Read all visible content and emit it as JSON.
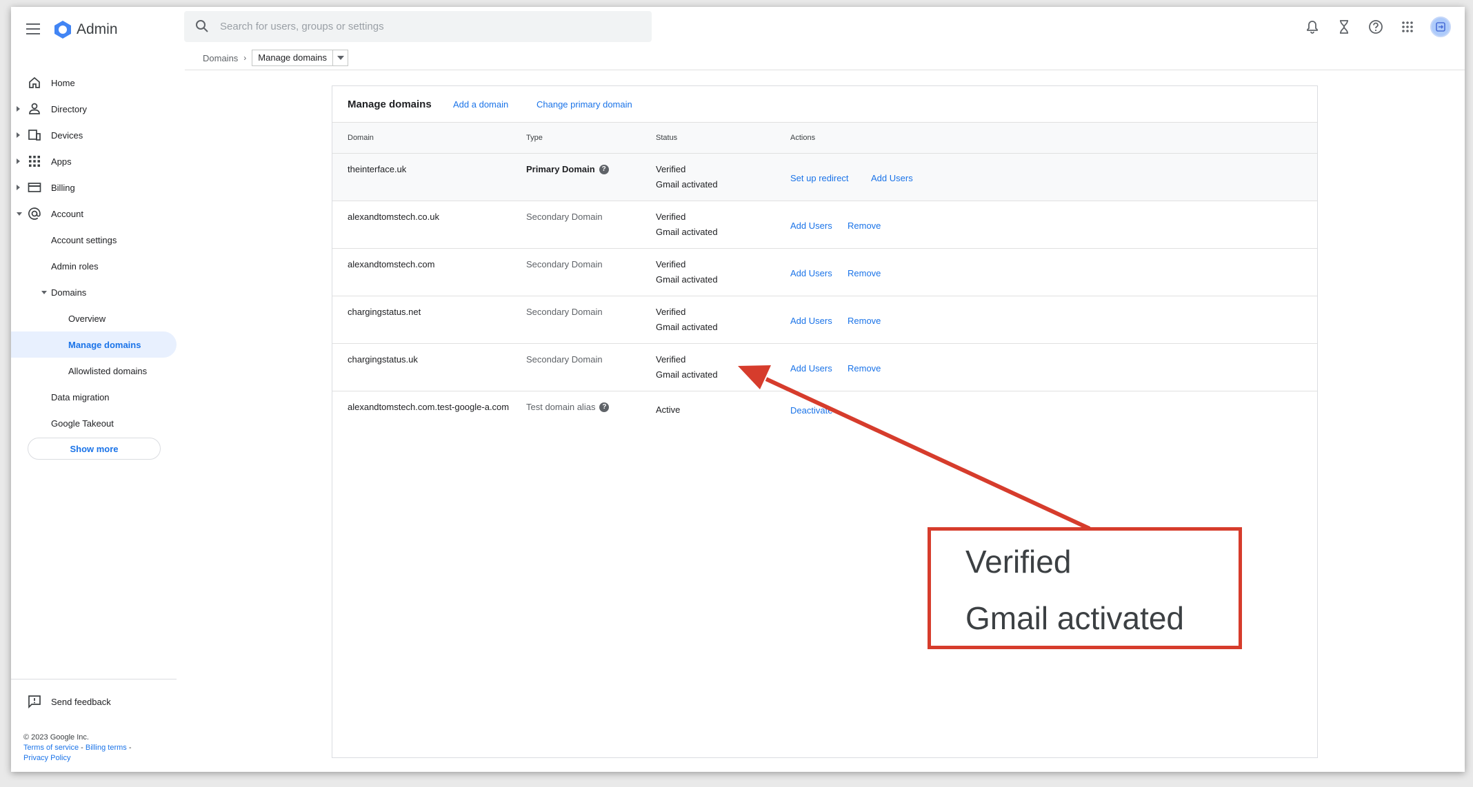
{
  "app": {
    "title": "Admin"
  },
  "search": {
    "placeholder": "Search for users, groups or settings"
  },
  "breadcrumb": {
    "parent": "Domains",
    "current": "Manage domains"
  },
  "sidebar": {
    "items": [
      {
        "label": "Home"
      },
      {
        "label": "Directory"
      },
      {
        "label": "Devices"
      },
      {
        "label": "Apps"
      },
      {
        "label": "Billing"
      },
      {
        "label": "Account"
      },
      {
        "label": "Account settings"
      },
      {
        "label": "Admin roles"
      },
      {
        "label": "Domains"
      },
      {
        "label": "Overview"
      },
      {
        "label": "Manage domains"
      },
      {
        "label": "Allowlisted domains"
      },
      {
        "label": "Data migration"
      },
      {
        "label": "Google Takeout"
      }
    ],
    "show_more": "Show more",
    "feedback": "Send feedback"
  },
  "footer": {
    "copyright": "© 2023 Google Inc.",
    "terms": "Terms of service",
    "billing_terms": "Billing terms",
    "privacy": "Privacy Policy",
    "sep": "-"
  },
  "card": {
    "title": "Manage domains",
    "add_domain": "Add a domain",
    "change_primary": "Change primary domain",
    "columns": [
      "Domain",
      "Type",
      "Status",
      "Actions"
    ],
    "rows": [
      {
        "domain": "theinterface.uk",
        "type": "Primary Domain",
        "status1": "Verified",
        "status2": "Gmail activated",
        "action1": "Set up redirect",
        "action2": "Add Users"
      },
      {
        "domain": "alexandtomstech.co.uk",
        "type": "Secondary Domain",
        "status1": "Verified",
        "status2": "Gmail activated",
        "action1": "Add Users",
        "action2": "Remove"
      },
      {
        "domain": "alexandtomstech.com",
        "type": "Secondary Domain",
        "status1": "Verified",
        "status2": "Gmail activated",
        "action1": "Add Users",
        "action2": "Remove"
      },
      {
        "domain": "chargingstatus.net",
        "type": "Secondary Domain",
        "status1": "Verified",
        "status2": "Gmail activated",
        "action1": "Add Users",
        "action2": "Remove"
      },
      {
        "domain": "chargingstatus.uk",
        "type": "Secondary Domain",
        "status1": "Verified",
        "status2": "Gmail activated",
        "action1": "Add Users",
        "action2": "Remove"
      },
      {
        "domain": "alexandtomstech.com.test-google-a.com",
        "type": "Test domain alias",
        "status1": "Active",
        "status2": "",
        "action1": "Deactivate",
        "action2": ""
      }
    ]
  },
  "callout": {
    "line1": "Verified",
    "line2": "Gmail activated"
  },
  "colors": {
    "accent": "#1a73e8",
    "annotation": "#d63c2c",
    "active_nav_bg": "#e8f0fe"
  }
}
